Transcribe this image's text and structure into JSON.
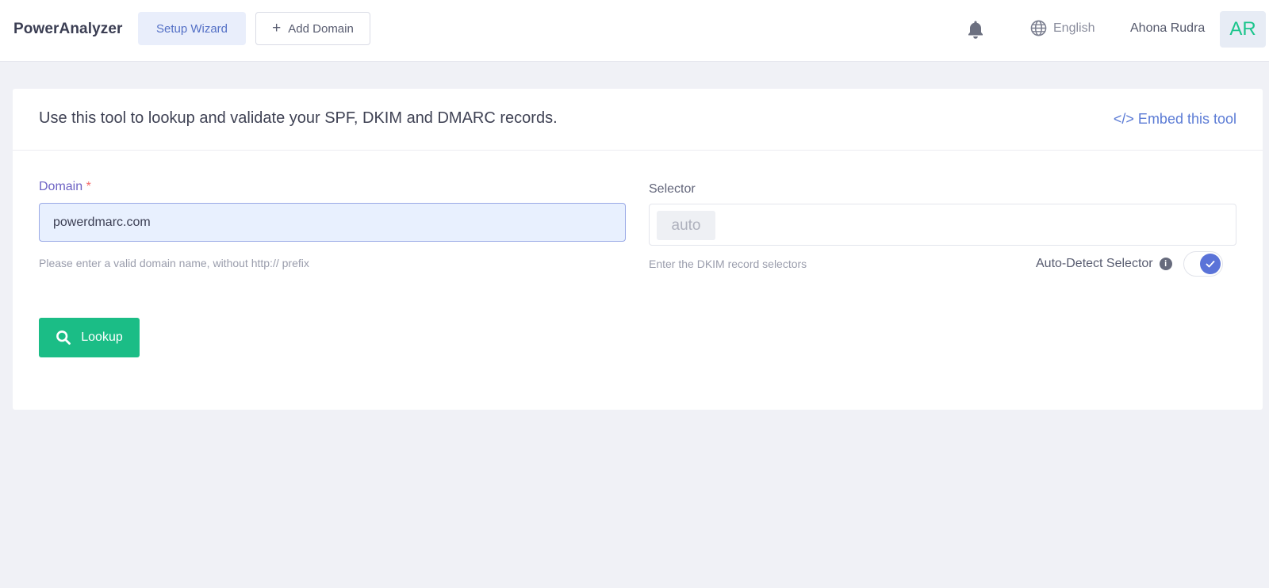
{
  "header": {
    "brand": "PowerAnalyzer",
    "setup_wizard_label": "Setup Wizard",
    "add_domain_label": "Add Domain",
    "language": "English",
    "user_name": "Ahona Rudra",
    "avatar_initials": "AR"
  },
  "card": {
    "title": "Use this tool to lookup and validate your SPF, DKIM and DMARC records.",
    "embed_link": "</> Embed this tool"
  },
  "form": {
    "domain_label": "Domain",
    "domain_required_mark": "*",
    "domain_value": "powerdmarc.com",
    "domain_help": "Please enter a valid domain name, without http:// prefix",
    "selector_label": "Selector",
    "selector_chip": "auto",
    "selector_help": "Enter the DKIM record selectors",
    "auto_detect_label": "Auto-Detect Selector",
    "auto_detect_enabled": true,
    "lookup_label": "Lookup"
  },
  "colors": {
    "accent": "#5a73d8",
    "primary_button": "#1bbd86",
    "avatar_text": "#1bc58c"
  },
  "icons": [
    "plus-icon",
    "bell-icon",
    "globe-icon",
    "info-icon",
    "check-icon",
    "search-icon"
  ]
}
